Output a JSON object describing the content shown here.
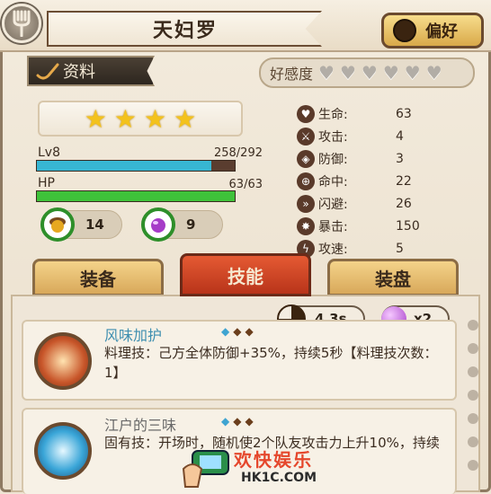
{
  "header": {
    "title": "天妇罗",
    "pref_label": "偏好"
  },
  "info_tab": {
    "label": "资料"
  },
  "favor": {
    "label": "好感度",
    "hearts_filled": 0,
    "hearts_total": 6
  },
  "stats": {
    "stars": 4,
    "level_label": "Lv8",
    "exp_text": "258/292",
    "exp_current": 258,
    "exp_max": 292,
    "hp_label": "HP",
    "hp_text": "63/63",
    "hp_current": 63,
    "hp_max": 63,
    "items": [
      {
        "icon": "acorn-icon",
        "count": "14"
      },
      {
        "icon": "purple-gem-icon",
        "count": "9"
      }
    ]
  },
  "attributes": [
    {
      "icon": "heart-icon",
      "name": "生命:",
      "value": "63"
    },
    {
      "icon": "sword-icon",
      "name": "攻击:",
      "value": "4"
    },
    {
      "icon": "shield-icon",
      "name": "防御:",
      "value": "3"
    },
    {
      "icon": "crosshair-icon",
      "name": "命中:",
      "value": "22"
    },
    {
      "icon": "dodge-icon",
      "name": "闪避:",
      "value": "26"
    },
    {
      "icon": "critical-icon",
      "name": "暴击:",
      "value": "150"
    },
    {
      "icon": "speed-icon",
      "name": "攻速:",
      "value": "5"
    }
  ],
  "tabs": [
    {
      "label": "装备"
    },
    {
      "label": "技能"
    },
    {
      "label": "装盘"
    }
  ],
  "skill_info": {
    "cooldown": "4.3s",
    "cost": "x2"
  },
  "skills": [
    {
      "name": "风味加护",
      "description": "料理技：己方全体防御+35%，持续5秒【料理技次数：1】"
    },
    {
      "name": "江户的三味",
      "description": "固有技：开场时，随机使2个队友攻击力上升10%，持续"
    }
  ],
  "watermark": {
    "text": "欢快娱乐",
    "url": "HK1C.COM"
  },
  "colors": {
    "exp_bar": "#37b6d3",
    "hp_bar": "#3fc23a",
    "skill_tab": "#d9451f",
    "skill_name": "#3f8fb0"
  }
}
